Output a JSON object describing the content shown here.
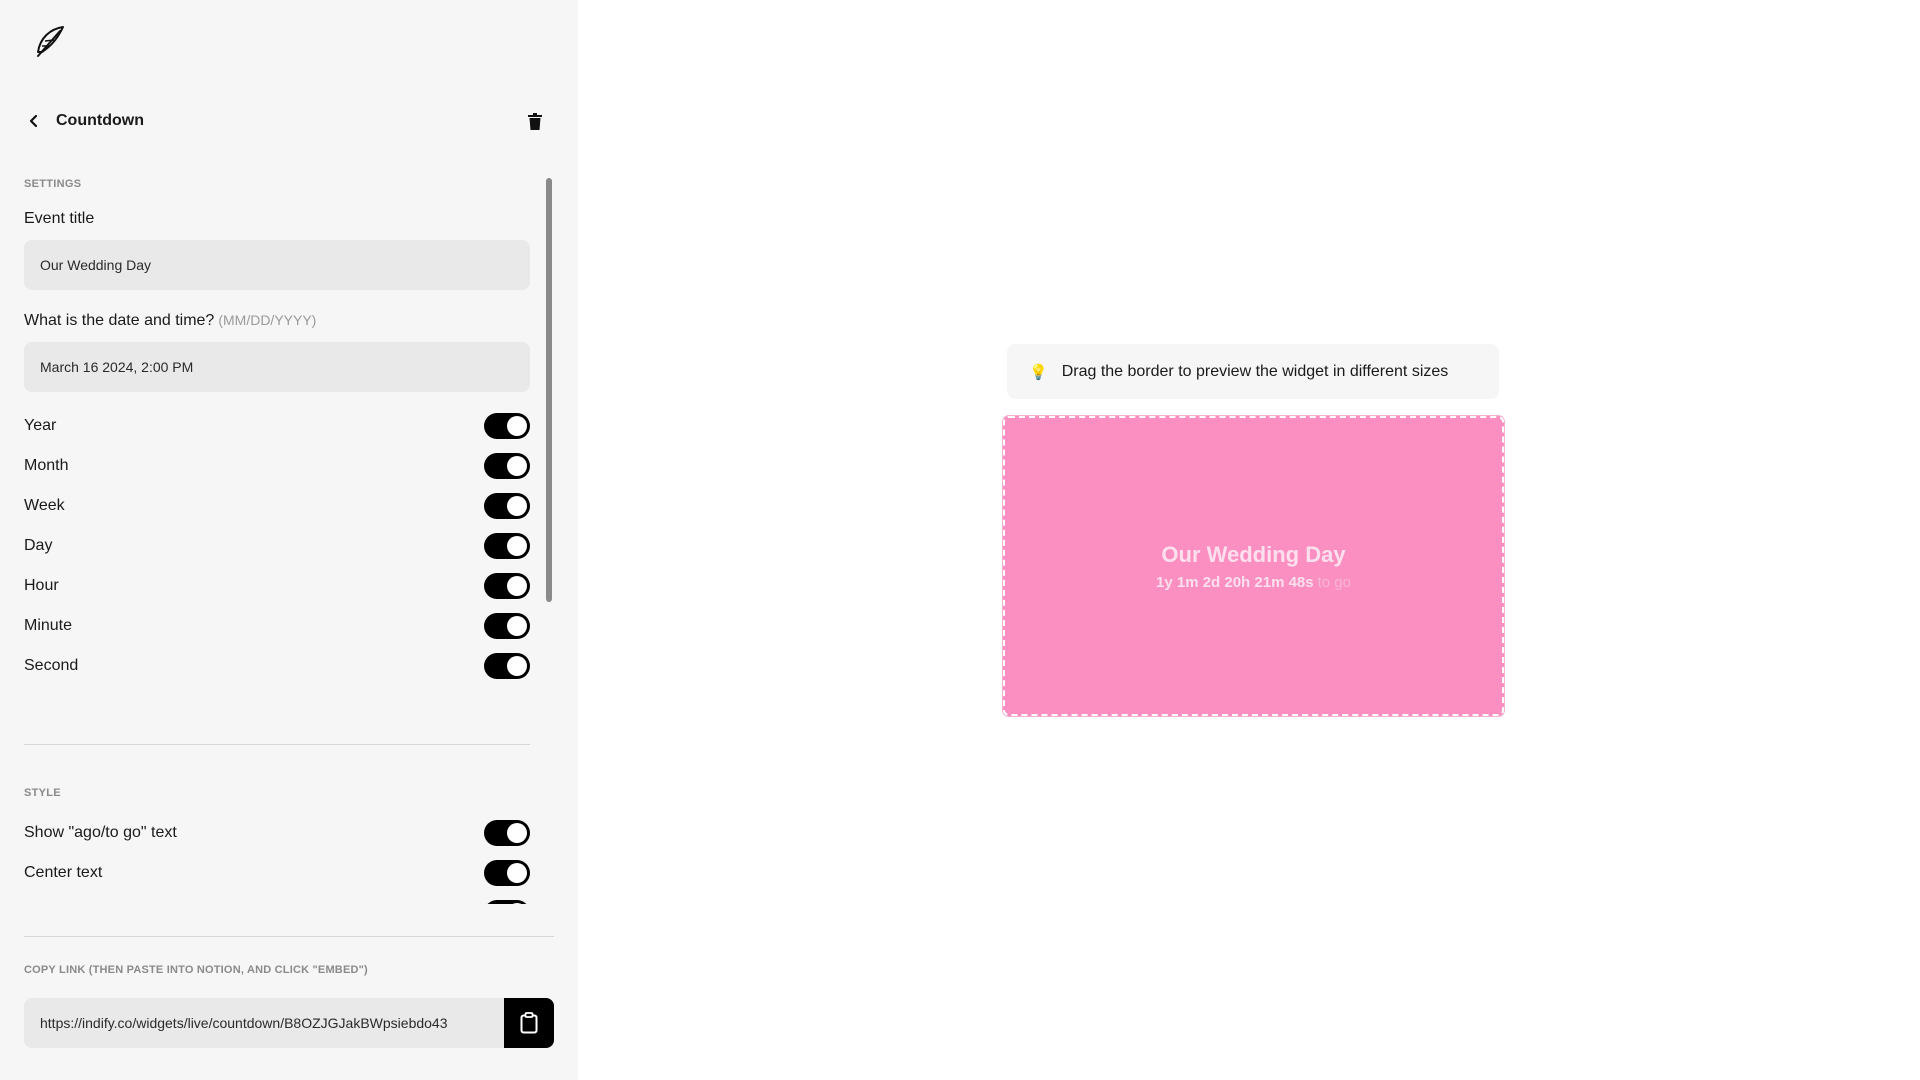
{
  "sidebar": {
    "header": {
      "title": "Countdown"
    },
    "settings": {
      "section_label": "SETTINGS",
      "event_title_label": "Event title",
      "event_title_value": "Our Wedding Day",
      "date_label": "What is the date and time?",
      "date_hint": "(MM/DD/YYYY)",
      "date_value": "March 16 2024, 2:00 PM",
      "toggles": [
        {
          "label": "Year",
          "on": true
        },
        {
          "label": "Month",
          "on": true
        },
        {
          "label": "Week",
          "on": true
        },
        {
          "label": "Day",
          "on": true
        },
        {
          "label": "Hour",
          "on": true
        },
        {
          "label": "Minute",
          "on": true
        },
        {
          "label": "Second",
          "on": true
        }
      ]
    },
    "style": {
      "section_label": "STYLE",
      "toggles": [
        {
          "label": "Show \"ago/to go\" text",
          "on": true
        },
        {
          "label": "Center text",
          "on": true
        }
      ]
    },
    "copy": {
      "label": "COPY LINK (THEN PASTE INTO NOTION, AND CLICK \"EMBED\")",
      "url": "https://indify.co/widgets/live/countdown/B8OZJGJakBWpsiebdo43"
    }
  },
  "preview": {
    "hint": "Drag the border to preview the widget in different sizes",
    "widget": {
      "title": "Our Wedding Day",
      "countdown": "1y 1m 2d 20h 21m 48s",
      "suffix": "to go",
      "background": "#fb8fc1"
    }
  },
  "icons": {
    "logo": "feather-icon",
    "back": "chevron-left-icon",
    "delete": "trash-icon",
    "copy": "clipboard-icon",
    "hint": "lightbulb-icon"
  }
}
